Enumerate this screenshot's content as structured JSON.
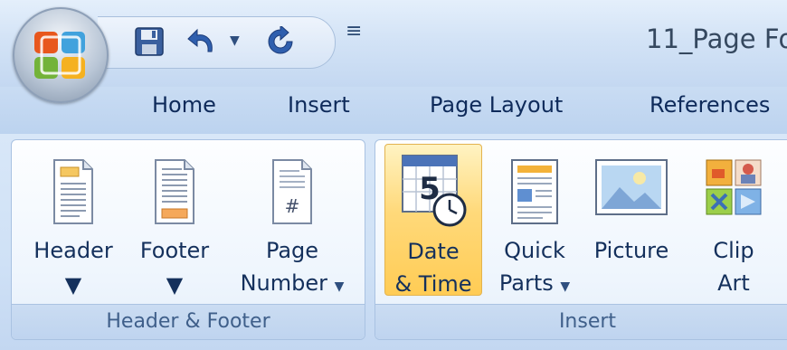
{
  "window": {
    "title": "11_Page Fo"
  },
  "quick_access": {
    "save_icon": "save-icon",
    "undo_icon": "undo-icon",
    "redo_icon": "redo-icon",
    "customize_glyph": "≡"
  },
  "tabs": [
    {
      "label": "Home"
    },
    {
      "label": "Insert"
    },
    {
      "label": "Page Layout"
    },
    {
      "label": "References"
    }
  ],
  "groups": {
    "header_footer": {
      "label": "Header & Footer",
      "header_label": "Header",
      "footer_label": "Footer",
      "page_number_line1": "Page",
      "page_number_line2": "Number"
    },
    "insert": {
      "label": "Insert",
      "date_time_line1": "Date",
      "date_time_line2": "& Time",
      "quick_parts_line1": "Quick",
      "quick_parts_line2": "Parts",
      "picture_label": "Picture",
      "clip_art_line1": "Clip",
      "clip_art_line2": "Art"
    }
  },
  "colors": {
    "accent_tab_text": "#0e2a5a",
    "active_button": "#ffd97a",
    "group_label_text": "#3f5f8a"
  }
}
